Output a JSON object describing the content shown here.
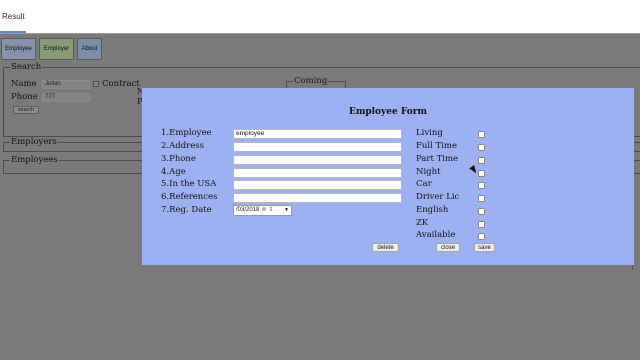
{
  "tab": {
    "label": "Result"
  },
  "nav": [
    "Employee",
    "Employer",
    "About"
  ],
  "search": {
    "legend": "Search",
    "name_label": "Name",
    "name_value": "Julian",
    "phone_label": "Phone",
    "phone_value": "777",
    "contract_label": "Contract",
    "search_button": "search",
    "coming_legend": "Coming",
    "partial_n": "N",
    "partial_p": "P"
  },
  "employers_legend": "Employers",
  "employees_legend": "Employees",
  "modal": {
    "title": "Employee Form",
    "fields": [
      {
        "label": "1.Employee",
        "value": "employee"
      },
      {
        "label": "2.Address",
        "value": ""
      },
      {
        "label": "3.Phone",
        "value": ""
      },
      {
        "label": "4.Age",
        "value": ""
      },
      {
        "label": "5.In the USA",
        "value": ""
      },
      {
        "label": "6.References",
        "value": ""
      }
    ],
    "date_label": "7.Reg. Date",
    "date_value": "/03/2018",
    "checks": [
      "Living",
      "Full Time",
      "Part Time",
      "Night",
      "Car",
      "Driver Lic",
      "English",
      "ZK",
      "Available"
    ],
    "buttons": {
      "delete": "delete",
      "close": "close",
      "save": "save"
    }
  }
}
